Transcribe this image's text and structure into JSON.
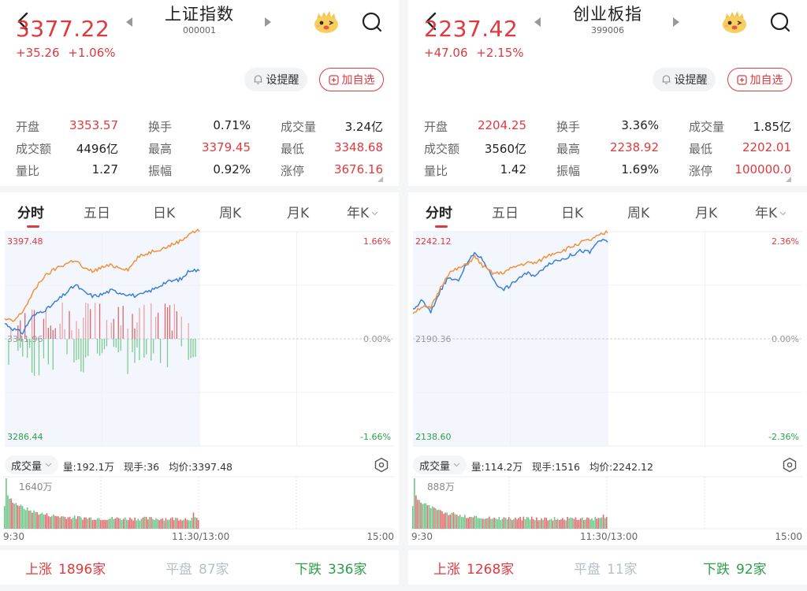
{
  "panels": [
    {
      "id": "left",
      "title": "上证指数",
      "code": "000001",
      "price": "3377.22",
      "change": "+35.26",
      "change_pct": "+1.06%",
      "alert_label": "设提醒",
      "fav_label": "加自选",
      "stats": [
        [
          {
            "label": "开盘",
            "value": "3353.57",
            "red": true
          },
          {
            "label": "换手",
            "value": "0.71%",
            "red": false
          },
          {
            "label": "成交量",
            "value": "3.24亿",
            "red": false
          }
        ],
        [
          {
            "label": "成交额",
            "value": "4496亿",
            "red": false
          },
          {
            "label": "最高",
            "value": "3379.45",
            "red": true
          },
          {
            "label": "最低",
            "value": "3348.68",
            "red": true
          }
        ],
        [
          {
            "label": "量比",
            "value": "1.27",
            "red": false
          },
          {
            "label": "振幅",
            "value": "0.92%",
            "red": false
          },
          {
            "label": "涨停",
            "value": "3676.16",
            "red": true
          }
        ]
      ],
      "tabs": [
        "分时",
        "五日",
        "日K",
        "周K",
        "月K",
        "年K"
      ],
      "active_tab": 0,
      "chart": {
        "y_top": "3397.48",
        "y_mid": "3341.96",
        "y_bottom": "3286.44",
        "pct_top": "1.66%",
        "pct_mid": "0.00%",
        "pct_bottom": "-1.66%"
      },
      "volume": {
        "selector": "成交量",
        "vol": "量:192.1万",
        "now_hand": "现手:36",
        "avg_price": "均价:3397.48",
        "max_label": "1640万"
      },
      "time_axis": [
        "9:30",
        "11:30/13:00",
        "15:00"
      ],
      "breadth": {
        "up_label": "上涨",
        "up_count": "1896家",
        "flat_label": "平盘",
        "flat_count": "87家",
        "down_label": "下跌",
        "down_count": "336家"
      }
    },
    {
      "id": "right",
      "title": "创业板指",
      "code": "399006",
      "price": "2237.42",
      "change": "+47.06",
      "change_pct": "+2.15%",
      "alert_label": "设提醒",
      "fav_label": "加自选",
      "stats": [
        [
          {
            "label": "开盘",
            "value": "2204.25",
            "red": true
          },
          {
            "label": "换手",
            "value": "3.36%",
            "red": false
          },
          {
            "label": "成交量",
            "value": "1.85亿",
            "red": false
          }
        ],
        [
          {
            "label": "成交额",
            "value": "3560亿",
            "red": false
          },
          {
            "label": "最高",
            "value": "2238.92",
            "red": true
          },
          {
            "label": "最低",
            "value": "2202.01",
            "red": true
          }
        ],
        [
          {
            "label": "量比",
            "value": "1.42",
            "red": false
          },
          {
            "label": "振幅",
            "value": "1.69%",
            "red": false
          },
          {
            "label": "涨停",
            "value": "100000.0",
            "red": true
          }
        ]
      ],
      "tabs": [
        "分时",
        "五日",
        "日K",
        "周K",
        "月K",
        "年K"
      ],
      "active_tab": 0,
      "chart": {
        "y_top": "2242.12",
        "y_mid": "2190.36",
        "y_bottom": "2138.60",
        "pct_top": "2.36%",
        "pct_mid": "0.00%",
        "pct_bottom": "-2.36%"
      },
      "volume": {
        "selector": "成交量",
        "vol": "量:114.2万",
        "now_hand": "现手:1516",
        "avg_price": "均价:2242.12",
        "max_label": "888万"
      },
      "time_axis": [
        "9:30",
        "11:30/13:00",
        "15:00"
      ],
      "breadth": {
        "up_label": "上涨",
        "up_count": "1268家",
        "flat_label": "平盘",
        "flat_count": "11家",
        "down_label": "下跌",
        "down_count": "92家"
      }
    }
  ],
  "colors": {
    "up": "#e0393e",
    "down": "#2e9f4a",
    "price_line": "#3b7fd9",
    "avg_line": "#f0923a",
    "flat": "#b8bfc9"
  },
  "chart_data": [
    {
      "type": "line",
      "title": "上证指数 分时",
      "ylim": [
        3286.44,
        3397.48
      ],
      "prev_close": 3341.96,
      "series": [
        {
          "name": "price",
          "values": [
            3350,
            3347,
            3345,
            3353,
            3356,
            3358,
            3362,
            3366,
            3370,
            3366,
            3364,
            3365,
            3367,
            3366,
            3365,
            3364,
            3366,
            3368,
            3371,
            3372,
            3373,
            3378,
            3377
          ]
        },
        {
          "name": "avg",
          "values": [
            3352,
            3351,
            3356,
            3364,
            3372,
            3376,
            3379,
            3381,
            3383,
            3378,
            3377,
            3379,
            3380,
            3379,
            3378,
            3384,
            3386,
            3388,
            3389,
            3391,
            3393,
            3397,
            3398
          ]
        }
      ]
    },
    {
      "type": "line",
      "title": "创业板指 分时",
      "ylim": [
        2138.6,
        2242.12
      ],
      "prev_close": 2190.36,
      "series": [
        {
          "name": "price",
          "values": [
            2204,
            2209,
            2203,
            2213,
            2220,
            2218,
            2226,
            2232,
            2228,
            2220,
            2214,
            2216,
            2220,
            2222,
            2221,
            2226,
            2228,
            2229,
            2231,
            2233,
            2232,
            2238,
            2237
          ]
        },
        {
          "name": "avg",
          "values": [
            2203,
            2206,
            2205,
            2214,
            2222,
            2224,
            2226,
            2230,
            2225,
            2222,
            2222,
            2224,
            2226,
            2227,
            2227,
            2230,
            2232,
            2233,
            2235,
            2237,
            2238,
            2240,
            2242
          ]
        }
      ]
    }
  ]
}
